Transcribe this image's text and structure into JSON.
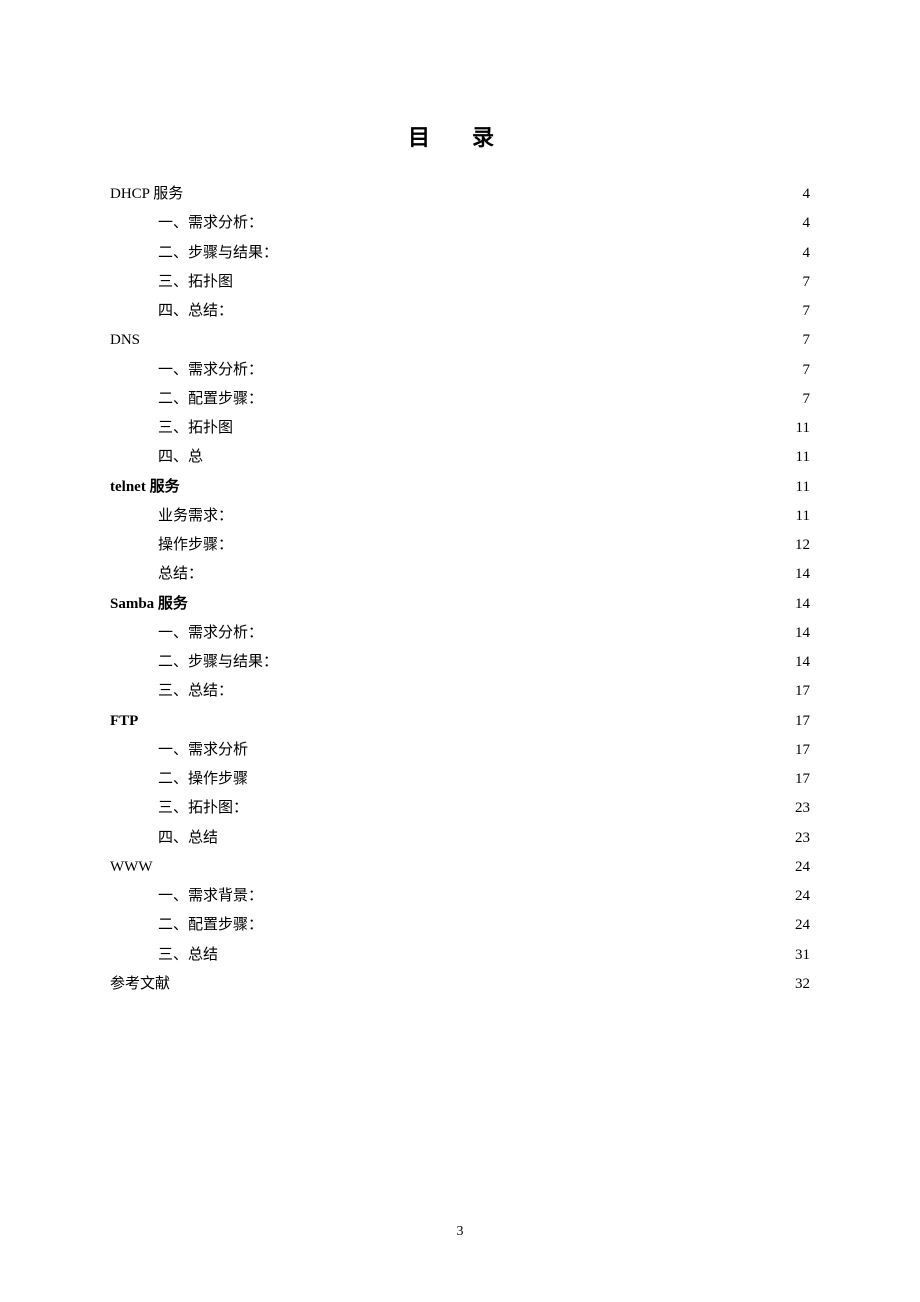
{
  "title": "目 录",
  "page_number": "3",
  "entries": [
    {
      "label": "DHCP 服务",
      "page": "4",
      "level": 0,
      "bold": false
    },
    {
      "label": "一、需求分析：",
      "page": "4",
      "level": 1,
      "bold": false
    },
    {
      "label": "二、步骤与结果：",
      "page": "4",
      "level": 1,
      "bold": false
    },
    {
      "label": "三、拓扑图",
      "page": "7",
      "level": 1,
      "bold": false
    },
    {
      "label": "四、总结：",
      "page": "7",
      "level": 1,
      "bold": false
    },
    {
      "label": "DNS",
      "page": "7",
      "level": 0,
      "bold": false
    },
    {
      "label": "一、需求分析：",
      "page": "7",
      "level": 1,
      "bold": false
    },
    {
      "label": "二、配置步骤：",
      "page": "7",
      "level": 1,
      "bold": false
    },
    {
      "label": "三、拓扑图",
      "page": "11",
      "level": 1,
      "bold": false
    },
    {
      "label": "四、总",
      "page": "11",
      "level": 1,
      "bold": false
    },
    {
      "label": "telnet 服务",
      "page": "11",
      "level": 0,
      "bold": true
    },
    {
      "label": "业务需求：",
      "page": "11",
      "level": 1,
      "bold": false
    },
    {
      "label": "操作步骤：",
      "page": "12",
      "level": 1,
      "bold": false
    },
    {
      "label": "总结：",
      "page": "14",
      "level": 1,
      "bold": false
    },
    {
      "label": "Samba 服务",
      "page": "14",
      "level": 0,
      "bold": true
    },
    {
      "label": "一、需求分析：",
      "page": "14",
      "level": 1,
      "bold": false
    },
    {
      "label": "二、步骤与结果：",
      "page": "14",
      "level": 1,
      "bold": false
    },
    {
      "label": "三、总结：",
      "page": "17",
      "level": 1,
      "bold": false
    },
    {
      "label": "FTP",
      "page": "17",
      "level": 0,
      "bold": true
    },
    {
      "label": "一、需求分析",
      "page": "17",
      "level": 1,
      "bold": false
    },
    {
      "label": "二、操作步骤",
      "page": "17",
      "level": 1,
      "bold": false
    },
    {
      "label": "三、拓扑图：",
      "page": "23",
      "level": 1,
      "bold": false
    },
    {
      "label": "四、总结",
      "page": "23",
      "level": 1,
      "bold": false
    },
    {
      "label": "WWW",
      "page": "24",
      "level": 0,
      "bold": false
    },
    {
      "label": "一、需求背景：",
      "page": "24",
      "level": 1,
      "bold": false
    },
    {
      "label": "二、配置步骤：",
      "page": "24",
      "level": 1,
      "bold": false
    },
    {
      "label": "三、总结",
      "page": "31",
      "level": 1,
      "bold": false
    },
    {
      "label": "参考文献",
      "page": "32",
      "level": 0,
      "bold": false
    }
  ]
}
